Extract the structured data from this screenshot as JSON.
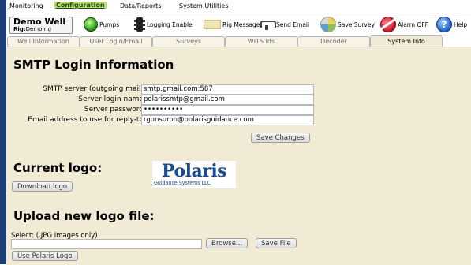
{
  "menu": {
    "items": [
      {
        "label": "Monitoring",
        "active": false
      },
      {
        "label": "Configuration",
        "active": true
      },
      {
        "label": "Data/Reports",
        "active": false
      },
      {
        "label": "System Utilities",
        "active": false
      }
    ]
  },
  "rig": {
    "title": "Demo Well",
    "sub_label": "Rig:",
    "sub_value": "Demo rig"
  },
  "toolbar": {
    "pumps": "Pumps",
    "logging_enable": "Logging Enable",
    "rig_message": "Rig Message",
    "send_email": "Send Email",
    "save_survey": "Save Survey",
    "alarm_off": "Alarm OFF",
    "help": "Help"
  },
  "tabs": [
    {
      "label": "Well Information",
      "active": false
    },
    {
      "label": "User Login/Email",
      "active": false
    },
    {
      "label": "Surveys",
      "active": false
    },
    {
      "label": "WITS Ids",
      "active": false
    },
    {
      "label": "Decoder",
      "active": false
    },
    {
      "label": "System Info",
      "active": true
    }
  ],
  "smtp": {
    "heading": "SMTP Login Information",
    "server_label": "SMTP server (outgoing mail):",
    "server_value": "smtp.gmail.com:587",
    "login_label": "Server login name:",
    "login_value": "polarissmtp@gmail.com",
    "password_label": "Server password:",
    "password_value": "••••••••••",
    "reply_label": "Email address to use for reply-to:",
    "reply_value": "rgonsuron@polarisguidance.com",
    "save_button": "Save Changes"
  },
  "logo": {
    "heading": "Current logo:",
    "download_button": "Download logo",
    "word": "Polaris",
    "sub": "Guidance Systems LLC"
  },
  "upload": {
    "heading": "Upload new logo file:",
    "select_label": "Select: (.JPG images only)",
    "browse_button": "Browse...",
    "save_file_button": "Save File",
    "use_polaris_button": "Use Polaris Logo"
  },
  "colors": {
    "frame": "#1c3f7a",
    "content_bg": "#f1ebd5",
    "menu_active_bg": "#b7d96b"
  }
}
